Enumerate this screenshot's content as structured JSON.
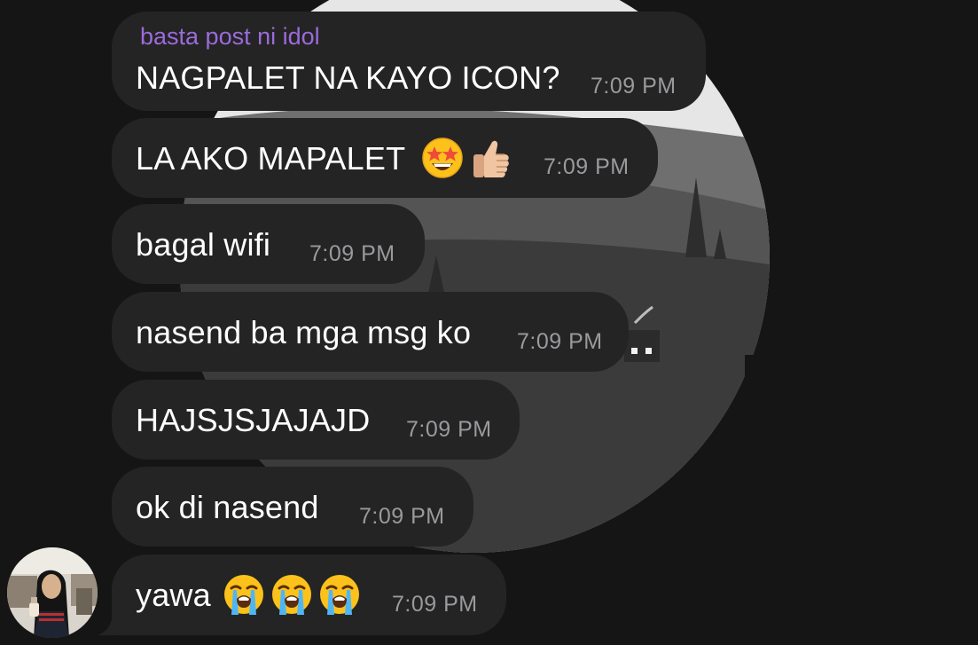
{
  "colors": {
    "background": "#151515",
    "bubble": "#242424",
    "sender_name": "#9b6bdc",
    "message_text": "#ffffff",
    "timestamp": "#9a9a9e"
  },
  "messages": [
    {
      "sender": "basta post ni idol",
      "text": "NAGPALET NA KAYO ICON?",
      "time": "7:09 PM",
      "emoji": []
    },
    {
      "text": "LA AKO MAPALET",
      "time": "7:09 PM",
      "emoji": [
        "star-struck-emoji",
        "thumbs-up-emoji"
      ]
    },
    {
      "text": "bagal wifi",
      "time": "7:09 PM",
      "emoji": []
    },
    {
      "text": "nasend ba mga msg ko",
      "time": "7:09 PM",
      "emoji": []
    },
    {
      "text": "HAJSJSJAJAJD",
      "time": "7:09 PM",
      "emoji": []
    },
    {
      "text": "ok di nasend",
      "time": "7:09 PM",
      "emoji": []
    },
    {
      "text": "yawa",
      "time": "7:09 PM",
      "emoji": [
        "loudly-crying-emoji",
        "loudly-crying-emoji",
        "loudly-crying-emoji"
      ]
    }
  ]
}
